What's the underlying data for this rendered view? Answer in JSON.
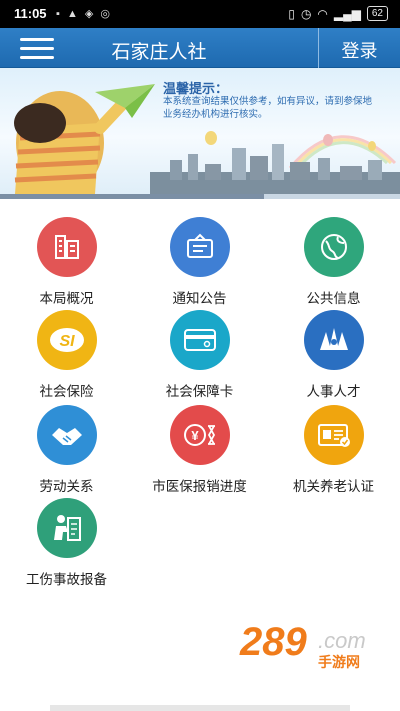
{
  "status_bar": {
    "time": "11:05",
    "battery": "62"
  },
  "header": {
    "title": "石家庄人社",
    "login_label": "登录"
  },
  "banner": {
    "tip_title": "温馨提示：",
    "tip_text": "本系统查询结果仅供参考，如有异议，请到参保地业务经办机构进行核实。"
  },
  "grid": {
    "items": [
      {
        "label": "本局概况",
        "color": "#e25555",
        "icon": "building-icon"
      },
      {
        "label": "通知公告",
        "color": "#3f7fd4",
        "icon": "notice-icon"
      },
      {
        "label": "公共信息",
        "color": "#2fa67c",
        "icon": "globe-icon"
      },
      {
        "label": "社会保险",
        "color": "#f0b514",
        "icon": "si-icon"
      },
      {
        "label": "社会保障卡",
        "color": "#1aa7c9",
        "icon": "card-icon"
      },
      {
        "label": "人事人才",
        "color": "#2a6fc1",
        "icon": "people-icon"
      },
      {
        "label": "劳动关系",
        "color": "#2f8fd6",
        "icon": "handshake-icon"
      },
      {
        "label": "市医保报销进度",
        "color": "#e34b4b",
        "icon": "yuan-icon"
      },
      {
        "label": "机关养老认证",
        "color": "#f0a50e",
        "icon": "id-card-icon"
      },
      {
        "label": "工伤事故报备",
        "color": "#2fa07a",
        "icon": "injury-icon"
      }
    ]
  },
  "watermark": {
    "number": "289",
    "site": ".com",
    "sub": "手游网"
  }
}
